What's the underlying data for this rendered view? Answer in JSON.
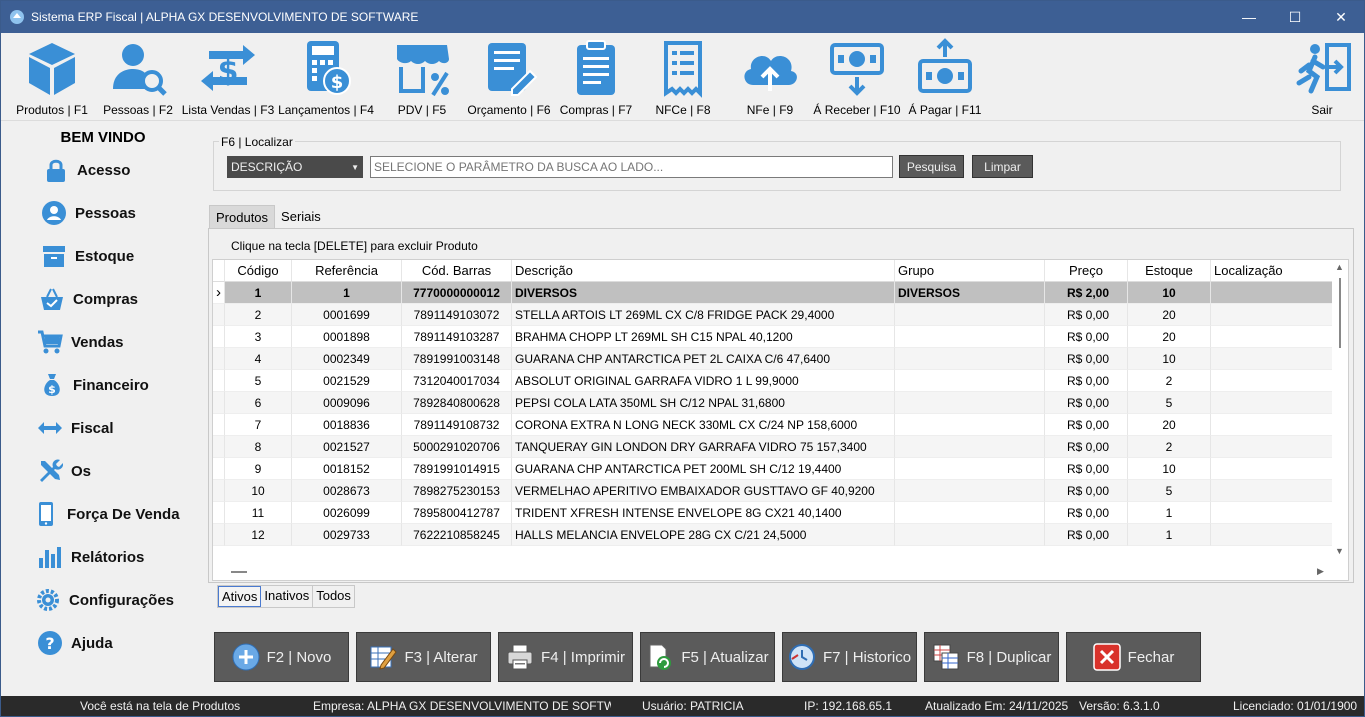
{
  "window": {
    "title": "Sistema ERP Fiscal | ALPHA GX DESENVOLVIMENTO DE SOFTWARE",
    "min": "—",
    "max": "☐",
    "close": "✕"
  },
  "toolbar": {
    "produtos": "Produtos | F1",
    "pessoas": "Pessoas | F2",
    "lista_vendas": "Lista Vendas | F3",
    "lancamentos": "Lançamentos | F4",
    "pdv": "PDV | F5",
    "orcamento": "Orçamento | F6",
    "compras": "Compras | F7",
    "nfce": "NFCe | F8",
    "nfe": "NFe | F9",
    "a_receber": "Á Receber | F10",
    "a_pagar": "Á Pagar | F11",
    "sair": "Sair"
  },
  "sidebar": {
    "title": "BEM VINDO",
    "items": [
      "Acesso",
      "Pessoas",
      "Estoque",
      "Compras",
      "Vendas",
      "Financeiro",
      "Fiscal",
      "Os",
      "Força De Venda",
      "Relátorios",
      "Configurações",
      "Ajuda"
    ]
  },
  "search": {
    "group_label": "F6 | Localizar",
    "param": "DESCRIÇÃO",
    "placeholder": "SELECIONE O PARÂMETRO DA BUSCA AO LADO...",
    "pesquisa": "Pesquisa",
    "limpar": "Limpar"
  },
  "tabs": {
    "produtos": "Produtos",
    "seriais": "Seriais"
  },
  "hint": "Clique na tecla [DELETE] para excluir Produto",
  "grid": {
    "columns": [
      "Código",
      "Referência",
      "Cód. Barras",
      "Descrição",
      "Grupo",
      "Preço",
      "Estoque",
      "Localização"
    ],
    "rows": [
      [
        "1",
        "1",
        "7770000000012",
        "DIVERSOS",
        "DIVERSOS",
        "R$ 2,00",
        "10",
        ""
      ],
      [
        "2",
        "0001699",
        "7891149103072",
        "STELLA ARTOIS LT 269ML CX C/8 FRIDGE PACK  29,4000",
        "",
        "R$ 0,00",
        "20",
        ""
      ],
      [
        "3",
        "0001898",
        "7891149103287",
        "BRAHMA CHOPP LT 269ML SH C15 NPAL          40,1200",
        "",
        "R$ 0,00",
        "20",
        ""
      ],
      [
        "4",
        "0002349",
        "7891991003148",
        "GUARANA CHP ANTARCTICA PET 2L CAIXA C/6     47,6400",
        "",
        "R$ 0,00",
        "10",
        ""
      ],
      [
        "5",
        "0021529",
        "7312040017034",
        "ABSOLUT ORIGINAL GARRAFA VIDRO 1 L           99,9000",
        "",
        "R$ 0,00",
        "2",
        ""
      ],
      [
        "6",
        "0009096",
        "7892840800628",
        "PEPSI COLA LATA 350ML SH C/12 NPAL          31,6800",
        "",
        "R$ 0,00",
        "5",
        ""
      ],
      [
        "7",
        "0018836",
        "7891149108732",
        "CORONA EXTRA N LONG NECK 330ML CX C/24 NP 158,6000",
        "",
        "R$ 0,00",
        "20",
        ""
      ],
      [
        "8",
        "0021527",
        "5000291020706",
        "TANQUERAY GIN LONDON DRY GARRAFA VIDRO 75 157,3400",
        "",
        "R$ 0,00",
        "2",
        ""
      ],
      [
        "9",
        "0018152",
        "7891991014915",
        "GUARANA CHP ANTARCTICA PET 200ML SH C/12   19,4400",
        "",
        "R$ 0,00",
        "10",
        ""
      ],
      [
        "10",
        "0028673",
        "7898275230153",
        "VERMELHAO APERITIVO EMBAIXADOR GUSTTAVO GF 40,9200",
        "",
        "R$ 0,00",
        "5",
        ""
      ],
      [
        "11",
        "0026099",
        "7895800412787",
        "TRIDENT XFRESH INTENSE ENVELOPE 8G CX21     40,1400",
        "",
        "R$ 0,00",
        "1",
        ""
      ],
      [
        "12",
        "0029733",
        "7622210858245",
        "HALLS MELANCIA ENVELOPE 28G CX C/21          24,5000",
        "",
        "R$ 0,00",
        "1",
        ""
      ]
    ]
  },
  "filters": {
    "ativos": "Ativos",
    "inativos": "Inativos",
    "todos": "Todos"
  },
  "actions": {
    "novo": "F2 | Novo",
    "alterar": "F3 | Alterar",
    "imprimir": "F4 | Imprimir",
    "atualizar": "F5 | Atualizar",
    "historico": "F7 | Historico",
    "duplicar": "F8 | Duplicar",
    "fechar": "Fechar"
  },
  "status": {
    "tela": "Você está na tela de Produtos",
    "empresa": "Empresa: ALPHA GX DESENVOLVIMENTO DE SOFTWAR",
    "usuario": "Usuário: PATRICIA",
    "ip": "IP: 192.168.65.1",
    "atualizado": "Atualizado Em: 24/11/2025",
    "versao": "Versão: 6.3.1.0",
    "licenciado": "Licenciado: 01/01/1900"
  },
  "colors": {
    "accent": "#3a8fd6",
    "titlebar": "#3d5f94",
    "button_dark": "#5b5b5b",
    "statusbar": "#2a2a2a"
  }
}
